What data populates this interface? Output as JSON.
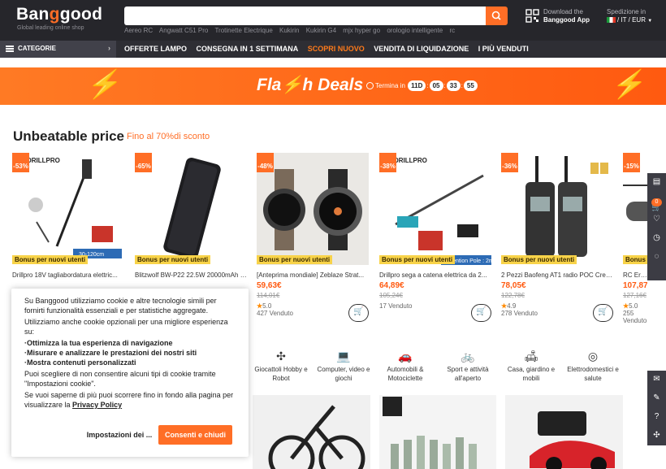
{
  "header": {
    "logo_text": "Banggood",
    "tagline": "Global leading online shop",
    "search_placeholder": "",
    "hot_words": [
      "Aereo RC",
      "Angwatt C51 Pro",
      "Trotinette Electrique",
      "Kukirin",
      "Kukirin G4",
      "mjx hyper go",
      "orologio intelligente",
      "rc"
    ],
    "app_line1": "Download the",
    "app_line2": "Banggood App",
    "ship_line1": "Spedizione in",
    "ship_line2": "/ IT / EUR",
    "accent_color": "#ff6e26"
  },
  "nav": {
    "category_label": "CATEGORIE",
    "links": [
      "OFFERTE LAMPO",
      "CONSEGNA IN 1 SETTIMANA",
      "SCOPRI NUOVO",
      "VENDITA DI LIQUIDAZIONE",
      "I PIÙ VENDUTI"
    ]
  },
  "flash": {
    "title": "Fla⚡h Deals",
    "ends_label": "Termina in",
    "days": "11D",
    "hours": "05",
    "minutes": "33",
    "seconds": "55"
  },
  "unbeatable": {
    "title": "Unbeatable price",
    "subtitle": "Fino al 70%di sconto",
    "bonus_label": "Bonus per nuovi utenti",
    "products": [
      {
        "discount": "-53%",
        "name": "Drillpro 18V tagliabordatura elettric...",
        "price": "",
        "old_price": "",
        "rating": "",
        "sold": ""
      },
      {
        "discount": "-65%",
        "name": "Blitzwolf BW-P22 22.5W 20000mAh P...",
        "price": "",
        "old_price": "",
        "rating": "",
        "sold": ""
      },
      {
        "discount": "-48%",
        "name": "[Anteprima mondiale] Zeblaze Strat...",
        "price": "59,63€",
        "old_price": "114,01€",
        "rating": "5.0",
        "sold": "427 Venduto"
      },
      {
        "discount": "-38%",
        "name": "Drillpro sega a catena elettrica da 2...",
        "price": "64,89€",
        "old_price": "105,24€",
        "rating": "",
        "sold": "17 Venduto"
      },
      {
        "discount": "-36%",
        "name": "2 Pezzi Baofeng AT1 radio POC Crea...",
        "price": "78,05€",
        "old_price": "122,78€",
        "rating": "4.9",
        "sold": "278 Venduto"
      },
      {
        "discount": "-15%",
        "name": "RC Era C...",
        "price": "107,87€",
        "old_price": "127,16€",
        "rating": "5.0",
        "sold": "255 Venduto"
      }
    ]
  },
  "categories": [
    {
      "label": "Giocattoli Hobby e Robot",
      "icon": "drone-icon"
    },
    {
      "label": "Computer, video e giochi",
      "icon": "laptop-icon"
    },
    {
      "label": "Automobili & Motociclette",
      "icon": "car-icon"
    },
    {
      "label": "Sport e attività all'aperto",
      "icon": "bicycle-icon"
    },
    {
      "label": "Casa, giardino e mobili",
      "icon": "sofa-icon"
    },
    {
      "label": "Elettrodomestici e salute",
      "icon": "appliance-icon"
    }
  ],
  "cookie": {
    "intro": "Su Banggood utilizziamo cookie e altre tecnologie simili per fornirti funzionalità essenziali e per statistiche aggregate.",
    "optional": "Utilizziamo anche cookie opzionali per una migliore esperienza su:",
    "bullet1": "·Ottimizza la tua esperienza di navigazione",
    "bullet2": "·Misurare e analizzare le prestazioni dei nostri siti",
    "bullet3": "·Mostra contenuti personalizzati",
    "refuse": "Puoi scegliere di non consentire alcuni tipi di cookie tramite \"Impostazioni cookie\".",
    "more": "Se vuoi saperne di più puoi scorrere fino in fondo alla pagina per visualizzare la",
    "policy_link": "Privacy Policy",
    "settings_button": "Impostazioni dei ...",
    "accept_button": "Consenti e chiudi"
  },
  "side_rail": {
    "cart_count": "0"
  }
}
